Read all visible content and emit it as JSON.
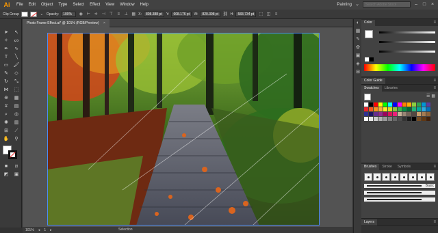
{
  "app": {
    "logo": "Ai",
    "menu": [
      "File",
      "Edit",
      "Object",
      "Type",
      "Select",
      "Effect",
      "View",
      "Window",
      "Help"
    ],
    "workspace": "Painting",
    "search_placeholder": "Search Adobe Stock"
  },
  "control_bar": {
    "selection_label": "Clip Group",
    "opacity_label": "Opacity:",
    "opacity_value": "100%",
    "x_label": "X:",
    "x_value": "808.388 pt",
    "y_label": "Y:",
    "y_value": "608.176 pt",
    "w_label": "W:",
    "w_value": "820.398 pt",
    "h_label": "H:",
    "h_value": "583.734 pt"
  },
  "document": {
    "tab_title": "Photo Frame Effect.ai* @ 101% (RGB/Preview)",
    "close_glyph": "×"
  },
  "status_bar": {
    "zoom": "101%",
    "artboard_number": "1",
    "current_tool": "Selection"
  },
  "panels": {
    "color_tab": "Color",
    "color_guide_tab": "Color Guide",
    "swatches_tab": "Swatches",
    "libraries_tab": "Libraries",
    "brushes_tab": "Brushes",
    "strokes_tab": "Stroke",
    "symbols_tab": "Symbols",
    "layers_tab": "Layers",
    "brush_basic_label": "Basic",
    "swatch_colors": [
      "#ffffff",
      "#000000",
      "#ff0000",
      "#ffff00",
      "#00ff00",
      "#00ffff",
      "#0000ff",
      "#ff00ff",
      "#ff8000",
      "#ffb000",
      "#8ccf3f",
      "#30a050",
      "#0097d7",
      "#5a3ea1",
      "#e8252b",
      "#f15a24",
      "#f7931e",
      "#fbb03b",
      "#fcee21",
      "#d9e021",
      "#8cc63f",
      "#39b54a",
      "#009245",
      "#006837",
      "#22b573",
      "#00a99d",
      "#29abe2",
      "#0071bc",
      "#2e3192",
      "#1b1464",
      "#662d91",
      "#93278f",
      "#9e005d",
      "#d4145a",
      "#ed1e79",
      "#c7b299",
      "#998675",
      "#736357",
      "#534741",
      "#c69c6d",
      "#a67c52",
      "#8c6239",
      "#ffffff",
      "#e6e6e6",
      "#cccccc",
      "#b3b3b3",
      "#999999",
      "#808080",
      "#666666",
      "#4d4d4d",
      "#333333",
      "#1a1a1a",
      "#000000",
      "#754c24",
      "#603813",
      "#42210b"
    ]
  },
  "icons": {
    "tools": [
      "selection-tool-icon",
      "direct-selection-tool-icon",
      "magic-wand-tool-icon",
      "lasso-tool-icon",
      "pen-tool-icon",
      "curvature-tool-icon",
      "type-tool-icon",
      "line-tool-icon",
      "rectangle-tool-icon",
      "paintbrush-tool-icon",
      "shaper-tool-icon",
      "eraser-tool-icon",
      "rotate-tool-icon",
      "scale-tool-icon",
      "width-tool-icon",
      "free-transform-tool-icon",
      "shape-builder-tool-icon",
      "perspective-grid-tool-icon",
      "mesh-tool-icon",
      "gradient-tool-icon",
      "eyedropper-tool-icon",
      "blend-tool-icon",
      "symbol-sprayer-tool-icon",
      "column-graph-tool-icon",
      "artboard-tool-icon",
      "slice-tool-icon",
      "hand-tool-icon",
      "zoom-tool-icon"
    ]
  }
}
